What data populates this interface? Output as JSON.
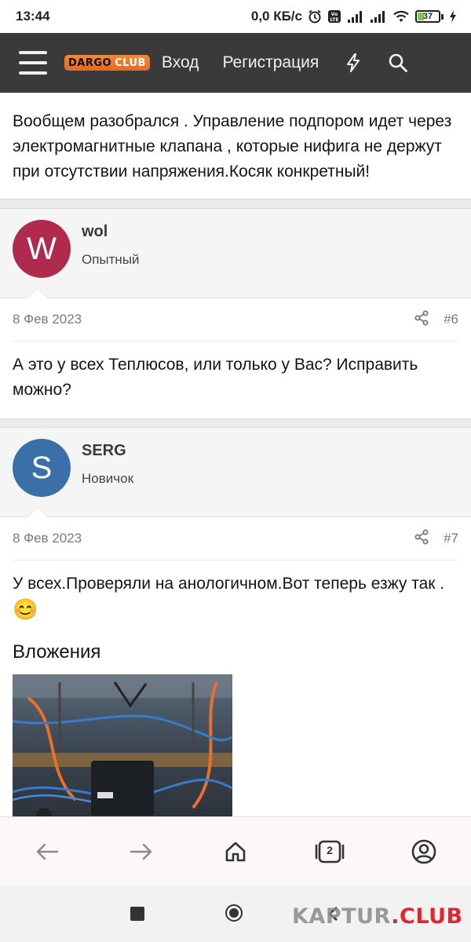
{
  "status_bar": {
    "time": "13:44",
    "network_speed": "0,0 КБ/с",
    "battery_level": "37"
  },
  "header": {
    "logo_main": "DARGO",
    "logo_sub": "CLUB",
    "login_label": "Вход",
    "register_label": "Регистрация"
  },
  "posts": [
    {
      "text": "Вообщем разобрался . Управление подпором идет через электромагнитные клапана , которые нифига не держут при отсутствии напряжения.Косяк конкретный!"
    },
    {
      "author": "wol",
      "avatar_letter": "W",
      "avatar_color": "#b02a4e",
      "role": "Опытный",
      "date": "8 Фев 2023",
      "number": "#6",
      "text": "А это у всех Теплюсов, или только у Вас? Исправить можно?"
    },
    {
      "author": "SERG",
      "avatar_letter": "S",
      "avatar_color": "#3b6fa8",
      "role": "Новичок",
      "date": "8 Фев 2023",
      "number": "#7",
      "text": "У всех.Проверяли на анологичном.Вот теперь езжу так .",
      "emoji": "😊",
      "attachments_title": "Вложения"
    }
  ],
  "bottom_nav": {
    "tab_count": "2"
  },
  "watermark": {
    "part1": "KAPTUR",
    "part2": ".CLUB"
  }
}
